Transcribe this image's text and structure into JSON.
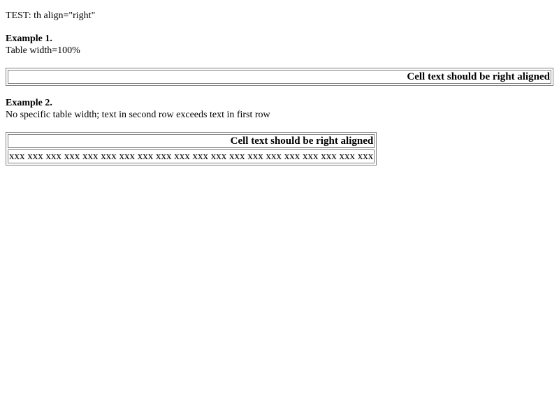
{
  "title": "TEST: th align=\"right\"",
  "example1": {
    "heading": "Example 1.",
    "description": "Table width=100%",
    "header_cell": "Cell text should be right aligned"
  },
  "example2": {
    "heading": "Example 2.",
    "description": "No specific table width; text in second row exceeds text in first row",
    "header_cell": "Cell text should be right aligned",
    "data_cell": "xxx xxx xxx xxx xxx xxx xxx xxx xxx xxx xxx xxx xxx xxx xxx xxx xxx xxx xxx xxx"
  }
}
